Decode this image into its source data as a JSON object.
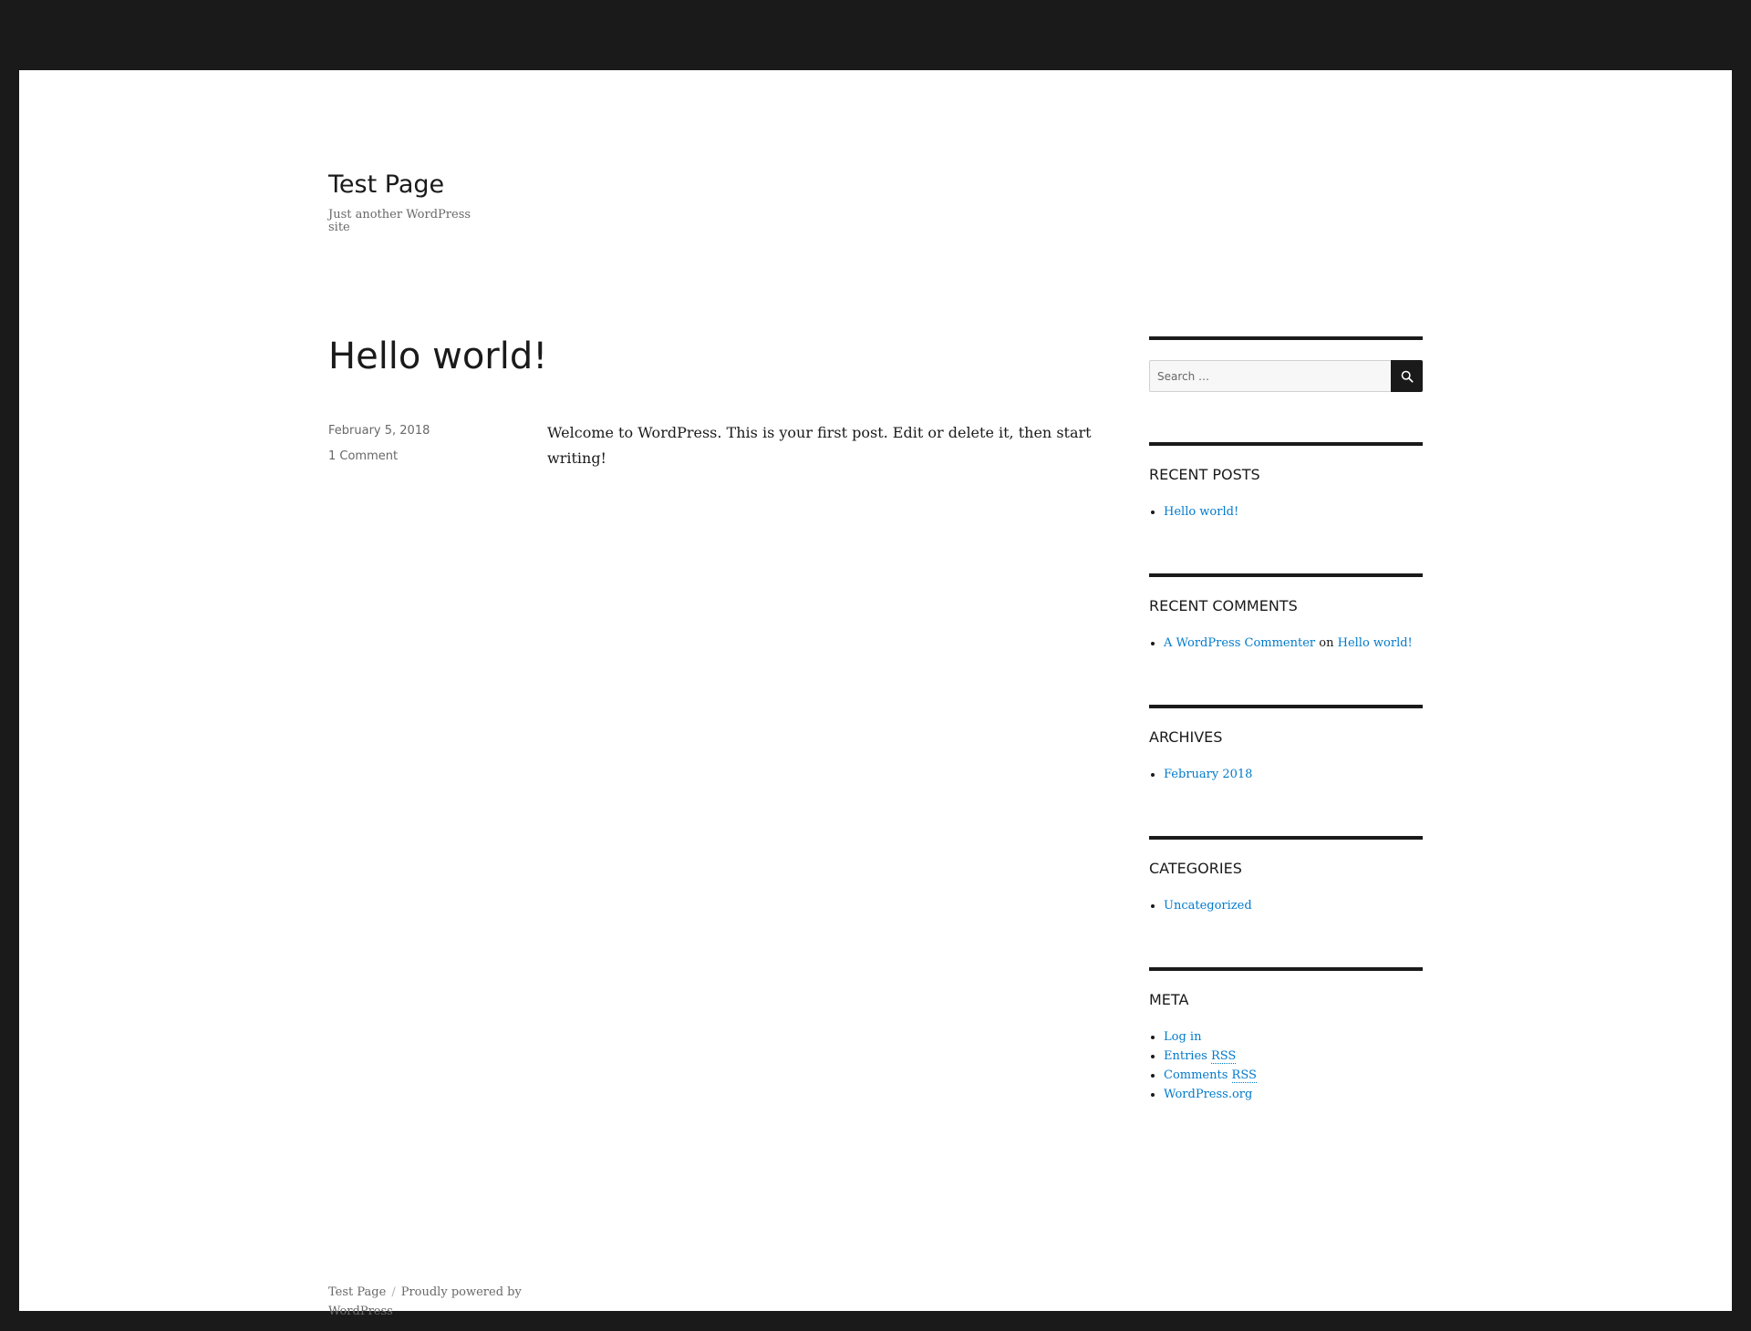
{
  "header": {
    "site_title": "Test Page",
    "site_description": "Just another WordPress site"
  },
  "post": {
    "title": "Hello world!",
    "date": "February 5, 2018",
    "comments": "1 Comment",
    "content": "Welcome to WordPress. This is your first post. Edit or delete it, then start writing!"
  },
  "sidebar": {
    "search": {
      "placeholder": "Search …",
      "button_icon": "search-icon"
    },
    "recent_posts": {
      "title": "Recent Posts",
      "items": [
        "Hello world!"
      ]
    },
    "recent_comments": {
      "title": "Recent Comments",
      "author": "A WordPress Commenter",
      "on": "on",
      "post": "Hello world!"
    },
    "archives": {
      "title": "Archives",
      "items": [
        "February 2018"
      ]
    },
    "categories": {
      "title": "Categories",
      "items": [
        "Uncategorized"
      ]
    },
    "meta": {
      "title": "Meta",
      "log_in": "Log in",
      "entries": "Entries",
      "comments": "Comments",
      "rss": "RSS",
      "wordpress_org": "WordPress.org"
    }
  },
  "footer": {
    "site_name": "Test Page",
    "separator": "/",
    "powered_by": "Proudly powered by WordPress"
  },
  "colors": {
    "frame": "#1a1a1a",
    "background": "#ffffff",
    "link": "#007acc",
    "muted_text": "#686868"
  }
}
